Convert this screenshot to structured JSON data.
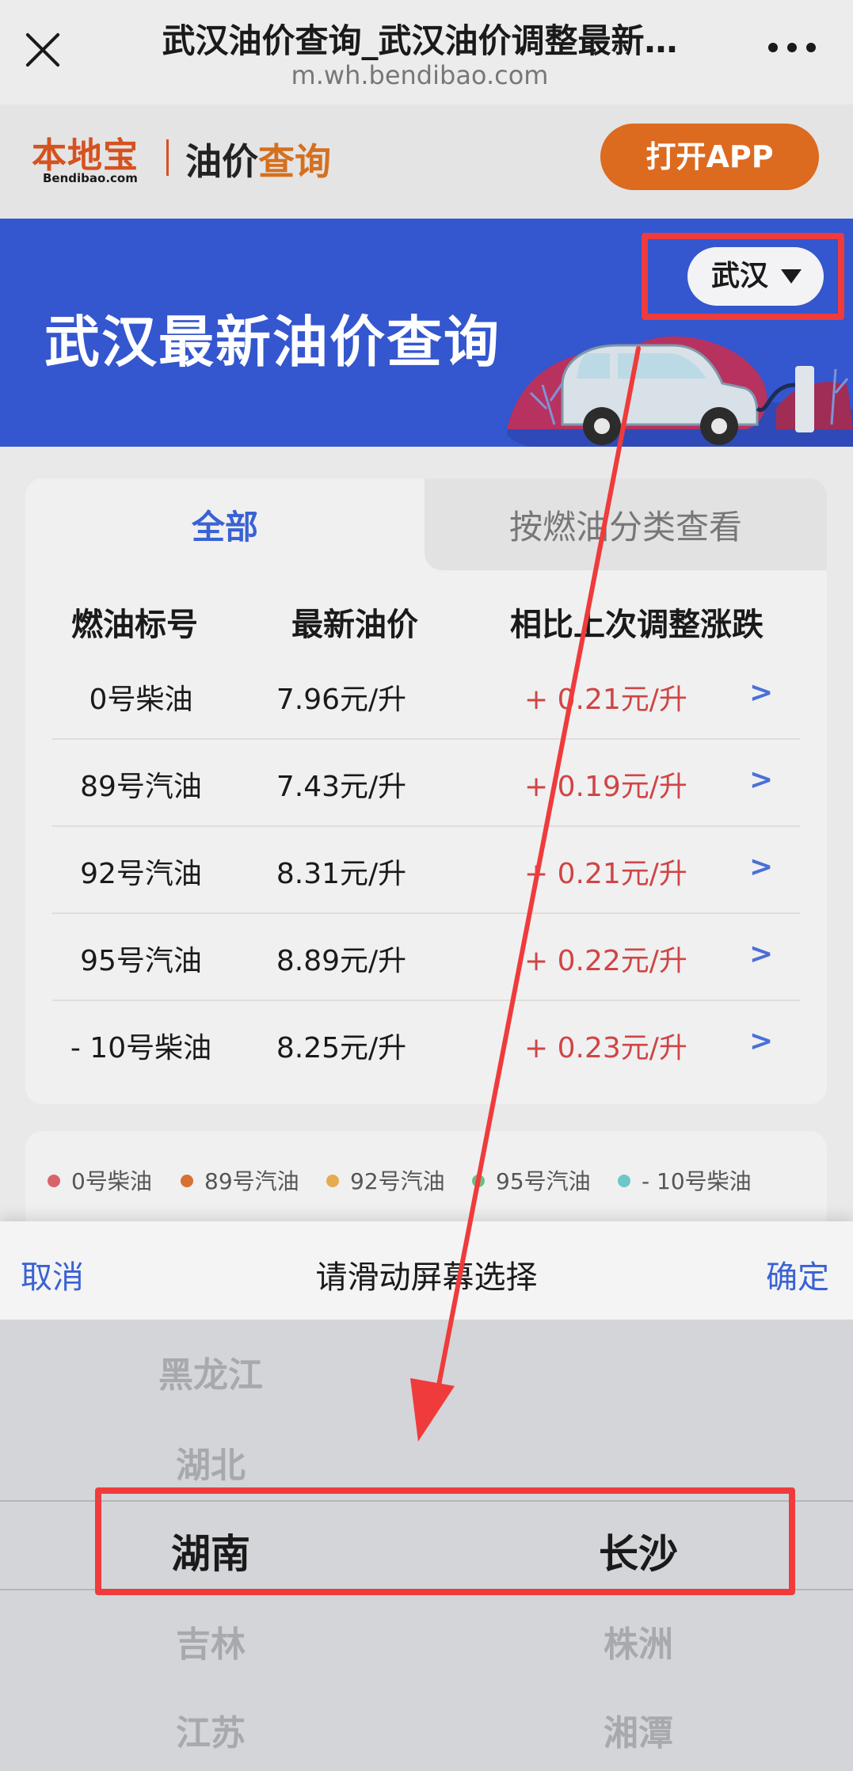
{
  "browser": {
    "title": "武汉油价查询_武汉油价调整最新…",
    "url": "m.wh.bendibao.com"
  },
  "header": {
    "logo_main": "本地宝",
    "logo_sub": "Bendibao.com",
    "title_prefix": "油价",
    "title_accent": "查询",
    "open_app": "打开APP"
  },
  "banner": {
    "title": "武汉最新油价查询",
    "city": "武汉"
  },
  "tabs": [
    "全部",
    "按燃油分类查看"
  ],
  "table": {
    "columns": [
      "燃油标号",
      "最新油价",
      "相比上次调整涨跌"
    ],
    "rows": [
      {
        "name": "0号柴油",
        "price": "7.96元/升",
        "change": "+ 0.21元/升",
        "go": ">"
      },
      {
        "name": "89号汽油",
        "price": "7.43元/升",
        "change": "+ 0.19元/升",
        "go": ">"
      },
      {
        "name": "92号汽油",
        "price": "8.31元/升",
        "change": "+ 0.21元/升",
        "go": ">"
      },
      {
        "name": "95号汽油",
        "price": "8.89元/升",
        "change": "+ 0.22元/升",
        "go": ">"
      },
      {
        "name": "- 10号柴油",
        "price": "8.25元/升",
        "change": "+ 0.23元/升",
        "go": ">"
      }
    ]
  },
  "legend": [
    {
      "label": "0号柴油",
      "color": "#d8636a"
    },
    {
      "label": "89号汽油",
      "color": "#d77131"
    },
    {
      "label": "92号汽油",
      "color": "#e6ab4f"
    },
    {
      "label": "95号汽油",
      "color": "#6cbf82"
    },
    {
      "label": "- 10号柴油",
      "color": "#6cc7c9"
    }
  ],
  "picker": {
    "cancel": "取消",
    "prompt": "请滑动屏幕选择",
    "confirm": "确定",
    "provinces": [
      "黑龙江",
      "湖北",
      "湖南",
      "吉林",
      "江苏"
    ],
    "cities": [
      "长沙",
      "株洲",
      "湘潭"
    ],
    "selected_province": "湖南",
    "selected_city": "长沙"
  },
  "colors": {
    "banner": "#3456cf",
    "accent_orange": "#dc6a1f",
    "link_blue": "#3a62d2",
    "rise_red": "#d04545",
    "annotation_red": "#ef3b3b"
  }
}
